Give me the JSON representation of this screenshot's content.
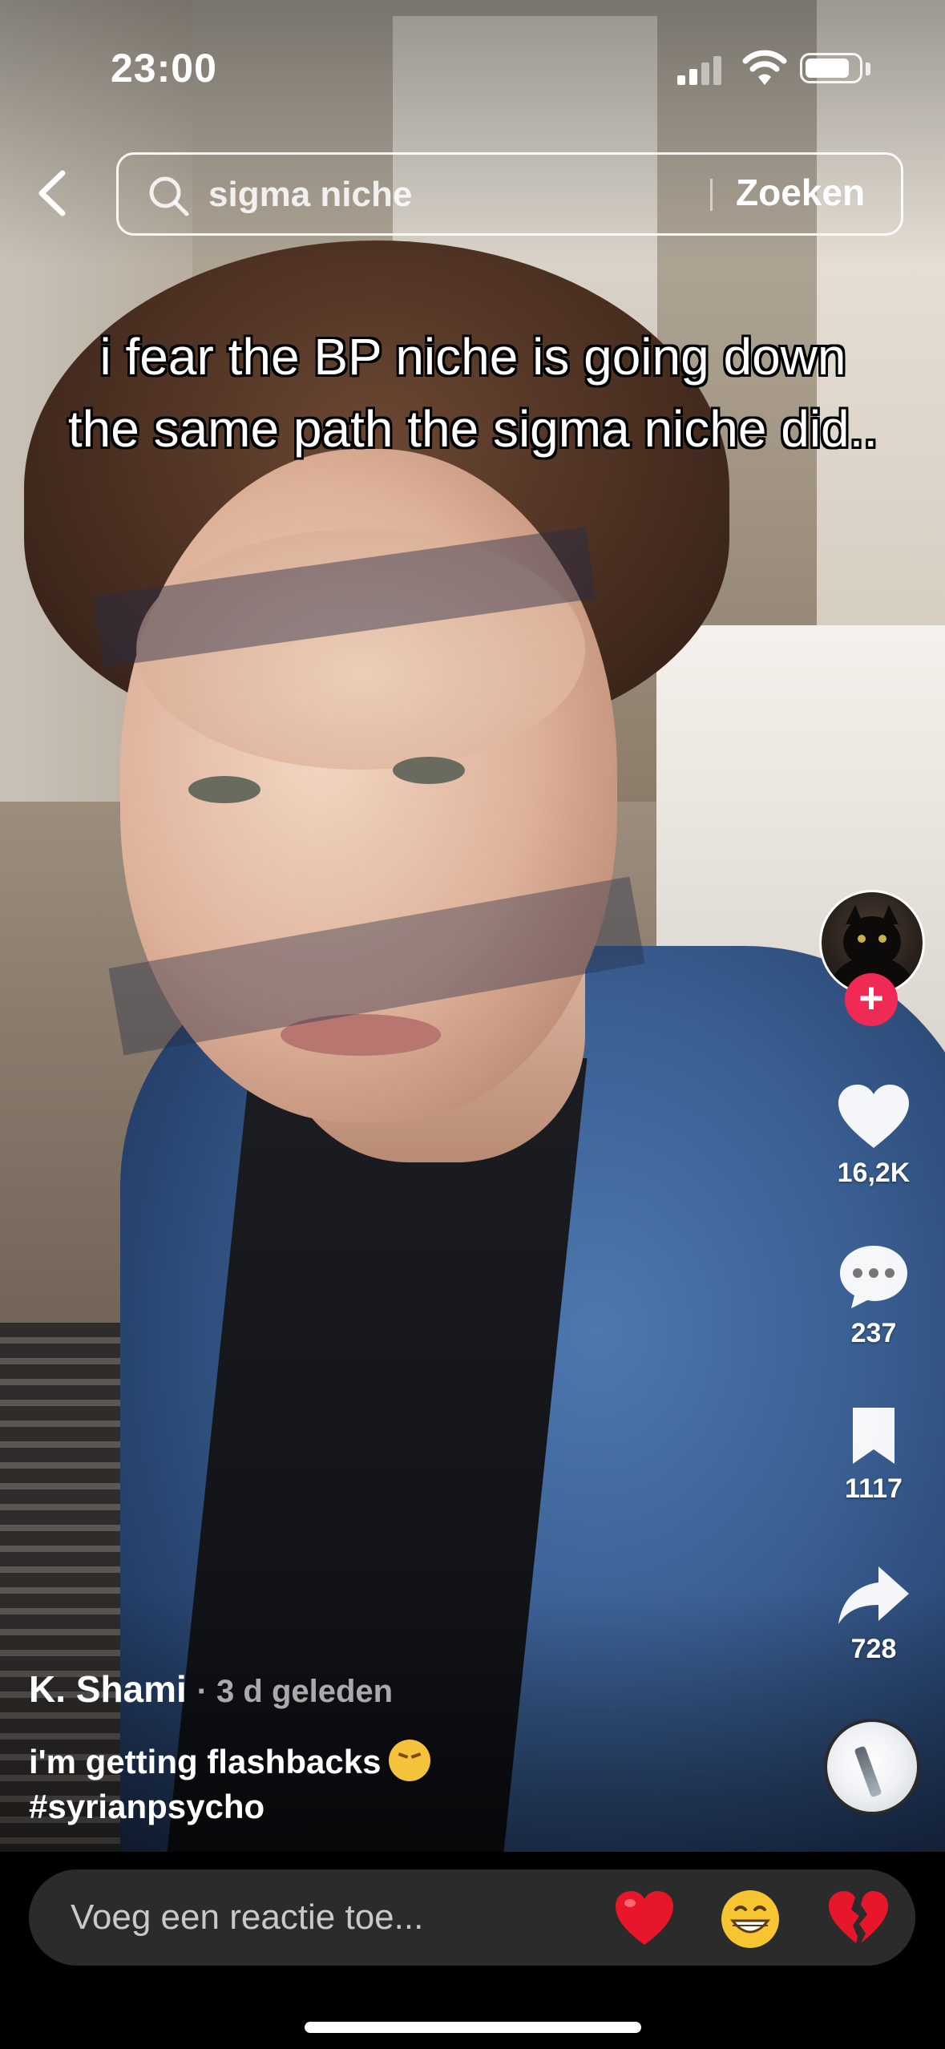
{
  "status_bar": {
    "time": "23:00",
    "signal_icon": "cellular-signal-icon",
    "wifi_icon": "wifi-icon",
    "battery_icon": "battery-icon",
    "battery_level": 0.85
  },
  "search": {
    "back_icon": "chevron-left-icon",
    "icon": "search-icon",
    "value": "sigma niche",
    "submit_label": "Zoeken"
  },
  "video": {
    "overlay_caption": "i fear the BP niche is going down the same path the sigma niche did.."
  },
  "actions": {
    "follow_icon": "plus-icon",
    "likes": "16,2K",
    "comments": "237",
    "saves": "1117",
    "shares": "728",
    "like_icon": "heart-icon",
    "comment_icon": "comment-bubble-icon",
    "save_icon": "bookmark-icon",
    "share_icon": "share-arrow-icon",
    "music_icon": "music-disc-icon"
  },
  "post": {
    "author": "K. Shami",
    "time_ago": "· 3 d geleden",
    "description": "i'm getting flashbacks",
    "description_emoji": "😞",
    "hashtag": "#syrianpsycho"
  },
  "comment_bar": {
    "placeholder": "Voeg een reactie toe...",
    "quick_emojis": [
      "heart-emoji",
      "grinning-emoji",
      "broken-heart-emoji"
    ]
  },
  "colors": {
    "follow_accent": "#ee2a55",
    "bar_background": "#000000",
    "pill_background": "#2b2b2c"
  }
}
